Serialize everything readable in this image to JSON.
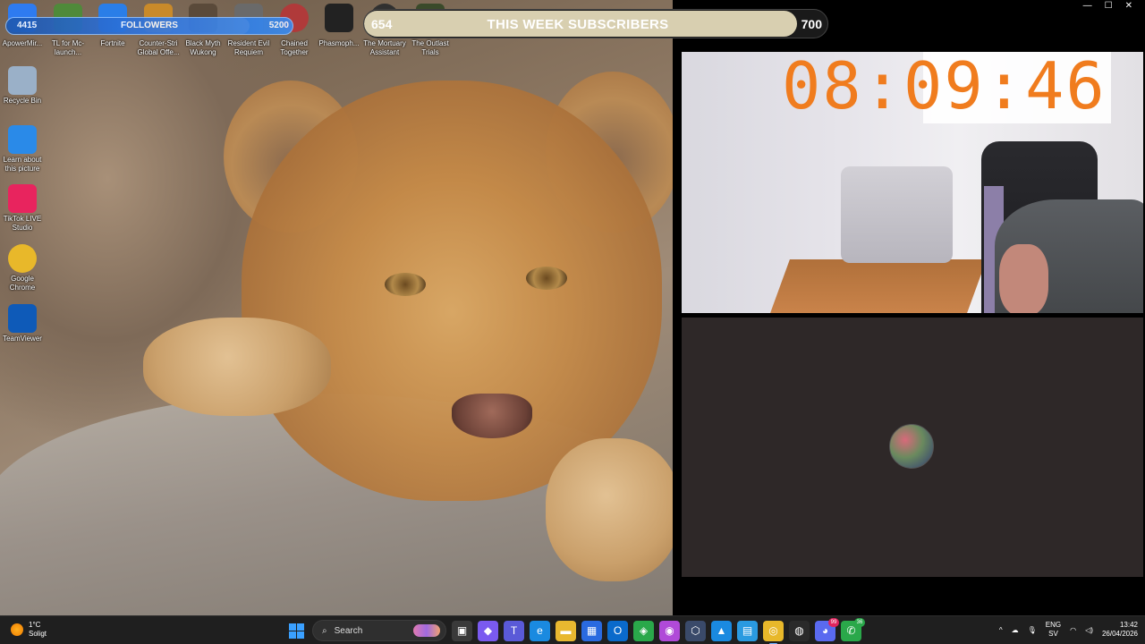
{
  "desktop": {
    "icons": [
      {
        "label": "ApowerMir...",
        "color": "#2e7bf0"
      },
      {
        "label": "TL for Mc-launch...",
        "color": "#4f8a3a"
      },
      {
        "label": "Fortnite",
        "color": "#2a7ee8"
      },
      {
        "label": "Counter-Stri Global Offe...",
        "color": "#c98a2a"
      },
      {
        "label": "Black Myth Wukong",
        "color": "#5a4a3a"
      },
      {
        "label": "Resident Evil Requiem",
        "color": "#6a6a6a"
      },
      {
        "label": "Chained Together",
        "color": "#b03a3a"
      },
      {
        "label": "Phasmoph...",
        "color": "#222222"
      },
      {
        "label": "The Mortuary Assistant",
        "color": "#303030"
      },
      {
        "label": "The Outlast Trials",
        "color": "#3a4a2a"
      },
      {
        "label": "Recycle Bin",
        "color": "#9ab0c8"
      },
      {
        "label": "Learn about this picture",
        "color": "#2a8ae8"
      },
      {
        "label": "TikTok LIVE Studio",
        "color": "#e8245e"
      },
      {
        "label": "Google Chrome",
        "color": "#e8b82a"
      },
      {
        "label": "TeamViewer",
        "color": "#0e5ab8"
      }
    ]
  },
  "overlay": {
    "followers": {
      "current": "4415",
      "label": "FOLLOWERS",
      "goal": "5200",
      "progress": 0.85
    },
    "subscribers": {
      "current": "654",
      "label": "THIS WEEK SUBSCRIBERS",
      "goal": "700",
      "progress": 0.934
    },
    "timer": "08:09:46"
  },
  "window": {
    "minimize": "—",
    "maximize": "☐",
    "close": "✕"
  },
  "taskbar": {
    "weather": {
      "temp": "1°C",
      "condition": "Soligt"
    },
    "search_label": "Search",
    "apps": [
      {
        "name": "task-view-icon",
        "glyph": "▣",
        "color": "#3a3a3a"
      },
      {
        "name": "copilot-icon",
        "glyph": "◆",
        "color": "#7a5af0"
      },
      {
        "name": "teams-icon",
        "glyph": "T",
        "color": "#5a5ad8"
      },
      {
        "name": "edge-icon",
        "glyph": "e",
        "color": "#1a8ae0"
      },
      {
        "name": "file-explorer-icon",
        "glyph": "▬",
        "color": "#e8b830"
      },
      {
        "name": "store-icon",
        "glyph": "▦",
        "color": "#2a6ae0"
      },
      {
        "name": "outlook-icon",
        "glyph": "O",
        "color": "#0a6acb"
      },
      {
        "name": "shield-icon",
        "glyph": "◈",
        "color": "#2aa84a"
      },
      {
        "name": "m365-icon",
        "glyph": "◉",
        "color": "#b04ad8"
      },
      {
        "name": "hex-app-icon",
        "glyph": "⬡",
        "color": "#3a4a6a"
      },
      {
        "name": "photos-icon",
        "glyph": "▲",
        "color": "#1a8ae0"
      },
      {
        "name": "gallery-icon",
        "glyph": "▤",
        "color": "#2a9ae0"
      },
      {
        "name": "chrome-icon",
        "glyph": "◎",
        "color": "#e8b82a"
      },
      {
        "name": "obs-icon",
        "glyph": "◍",
        "color": "#2a2a2a"
      },
      {
        "name": "discord-icon",
        "glyph": "◕",
        "color": "#5a6af0",
        "badge": "99"
      },
      {
        "name": "whatsapp-icon",
        "glyph": "✆",
        "color": "#2aa84a",
        "badge": "36"
      }
    ],
    "tray": {
      "chevron": "^",
      "lang_top": "ENG",
      "lang_bottom": "SV",
      "time": "13:42",
      "date": "26/04/2026"
    }
  }
}
